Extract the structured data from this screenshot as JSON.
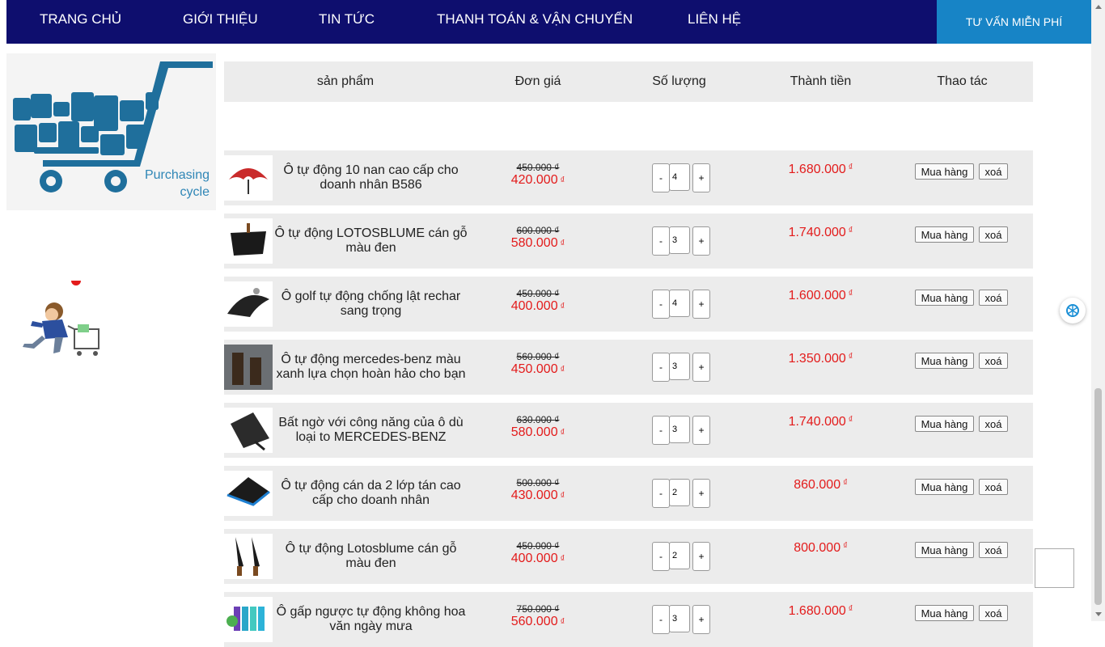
{
  "nav": {
    "items": [
      "TRANG CHỦ",
      "GIỚI THIỆU",
      "TIN TỨC",
      "THANH TOÁN & VẬN CHUYỂN",
      "LIÊN HỆ"
    ],
    "consult_label": "TƯ VẤN MIỄN PHÍ",
    "bg_color": "#0e0e6e",
    "consult_color": "#1784c6"
  },
  "banner": {
    "caption_line1": "Purchasing",
    "caption_line2": "cycle"
  },
  "table": {
    "headers": [
      "sản phẩm",
      "Đơn giá",
      "Số lượng",
      "Thành tiền",
      "Thao tác"
    ],
    "currency": "₫",
    "buy_label": "Mua hàng",
    "delete_label": "xoá",
    "minus_label": "-",
    "plus_label": "+",
    "rows": [
      {
        "name": "Ô tự động 10 nan cao cấp cho doanh nhân B586",
        "old_price": "450.000",
        "price": "420.000",
        "qty": "4",
        "total": "1.680.000",
        "icon": "red-umbrella"
      },
      {
        "name": "Ô tự động LOTOSBLUME cán gỗ màu đen",
        "old_price": "600.000",
        "price": "580.000",
        "qty": "3",
        "total": "1.740.000",
        "icon": "black-umbrella-wood"
      },
      {
        "name": "Ô golf tự động chống lật rechar sang trọng",
        "old_price": "450.000",
        "price": "400.000",
        "qty": "4",
        "total": "1.600.000",
        "icon": "black-golf-umbrella"
      },
      {
        "name": "Ô tự động mercedes-benz màu xanh lựa chọn hoàn hảo cho bạn",
        "old_price": "560.000",
        "price": "450.000",
        "qty": "3",
        "total": "1.350.000",
        "icon": "umbrella-handles"
      },
      {
        "name": "Bất ngờ với công năng của ô dù loại to MERCEDES-BENZ",
        "old_price": "630.000",
        "price": "580.000",
        "qty": "3",
        "total": "1.740.000",
        "icon": "folded-umbrella"
      },
      {
        "name": "Ô tự động cán da 2 lớp tán cao cấp cho doanh nhân",
        "old_price": "500.000",
        "price": "430.000",
        "qty": "2",
        "total": "860.000",
        "icon": "blue-lined-umbrella"
      },
      {
        "name": "Ô tự động Lotosblume cán gỗ màu đen",
        "old_price": "450.000",
        "price": "400.000",
        "qty": "2",
        "total": "800.000",
        "icon": "two-black-umbrellas"
      },
      {
        "name": "Ô gấp ngược tự động không hoa văn ngày mưa",
        "old_price": "750.000",
        "price": "560.000",
        "qty": "3",
        "total": "1.680.000",
        "icon": "colorful-umbrellas"
      }
    ]
  },
  "colors": {
    "price_red": "#e31b1b",
    "row_bg": "#ececec",
    "banner_caption": "#2f86b6"
  }
}
